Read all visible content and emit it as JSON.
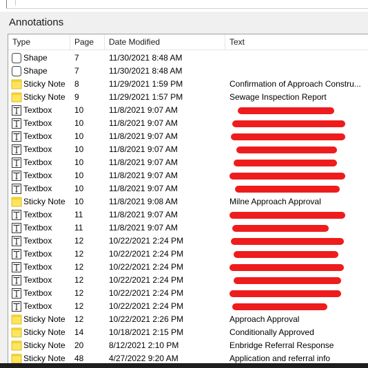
{
  "panel": {
    "title": "Annotations"
  },
  "columns": {
    "type": "Type",
    "page": "Page",
    "date": "Date Modified",
    "text": "Text"
  },
  "rows": [
    {
      "type": "Shape",
      "icon": "shape-icon",
      "page": "7",
      "date": "11/30/2021 8:48 AM",
      "text": ""
    },
    {
      "type": "Shape",
      "icon": "shape-icon",
      "page": "7",
      "date": "11/30/2021 8:48 AM",
      "text": ""
    },
    {
      "type": "Sticky Note",
      "icon": "sticky-note-icon",
      "page": "8",
      "date": "11/29/2021 1:59 PM",
      "text": "Confirmation of Approach Constru..."
    },
    {
      "type": "Sticky Note",
      "icon": "sticky-note-icon",
      "page": "9",
      "date": "11/29/2021 1:57 PM",
      "text": "Sewage Inspection Report"
    },
    {
      "type": "Textbox",
      "icon": "textbox-icon",
      "page": "10",
      "date": "11/8/2021 9:07 AM",
      "text": "",
      "redacted": true
    },
    {
      "type": "Textbox",
      "icon": "textbox-icon",
      "page": "10",
      "date": "11/8/2021 9:07 AM",
      "text": "",
      "redacted": true
    },
    {
      "type": "Textbox",
      "icon": "textbox-icon",
      "page": "10",
      "date": "11/8/2021 9:07 AM",
      "text": "",
      "redacted": true
    },
    {
      "type": "Textbox",
      "icon": "textbox-icon",
      "page": "10",
      "date": "11/8/2021 9:07 AM",
      "text": "",
      "redacted": true
    },
    {
      "type": "Textbox",
      "icon": "textbox-icon",
      "page": "10",
      "date": "11/8/2021 9:07 AM",
      "text": "",
      "redacted": true
    },
    {
      "type": "Textbox",
      "icon": "textbox-icon",
      "page": "10",
      "date": "11/8/2021 9:07 AM",
      "text": "",
      "redacted": true
    },
    {
      "type": "Textbox",
      "icon": "textbox-icon",
      "page": "10",
      "date": "11/8/2021 9:07 AM",
      "text": "",
      "redacted": true
    },
    {
      "type": "Sticky Note",
      "icon": "sticky-note-icon",
      "page": "10",
      "date": "11/8/2021 9:08 AM",
      "text": "Milne Approach Approval"
    },
    {
      "type": "Textbox",
      "icon": "textbox-icon",
      "page": "11",
      "date": "11/8/2021 9:07 AM",
      "text": "",
      "redacted": true
    },
    {
      "type": "Textbox",
      "icon": "textbox-icon",
      "page": "11",
      "date": "11/8/2021 9:07 AM",
      "text": "",
      "redacted": true
    },
    {
      "type": "Textbox",
      "icon": "textbox-icon",
      "page": "12",
      "date": "10/22/2021 2:24 PM",
      "text": "",
      "redacted": true
    },
    {
      "type": "Textbox",
      "icon": "textbox-icon",
      "page": "12",
      "date": "10/22/2021 2:24 PM",
      "text": "",
      "redacted": true
    },
    {
      "type": "Textbox",
      "icon": "textbox-icon",
      "page": "12",
      "date": "10/22/2021 2:24 PM",
      "text": "",
      "redacted": true
    },
    {
      "type": "Textbox",
      "icon": "textbox-icon",
      "page": "12",
      "date": "10/22/2021 2:24 PM",
      "text": "",
      "redacted": true
    },
    {
      "type": "Textbox",
      "icon": "textbox-icon",
      "page": "12",
      "date": "10/22/2021 2:24 PM",
      "text": "",
      "redacted": true
    },
    {
      "type": "Textbox",
      "icon": "textbox-icon",
      "page": "12",
      "date": "10/22/2021 2:24 PM",
      "text": "",
      "redacted": true
    },
    {
      "type": "Sticky Note",
      "icon": "sticky-note-icon",
      "page": "12",
      "date": "10/22/2021 2:26 PM",
      "text": "Approach Approval"
    },
    {
      "type": "Sticky Note",
      "icon": "sticky-note-icon",
      "page": "14",
      "date": "10/18/2021 2:15 PM",
      "text": "Conditionally Approved"
    },
    {
      "type": "Sticky Note",
      "icon": "sticky-note-icon",
      "page": "20",
      "date": "8/12/2021 2:10 PM",
      "text": "Enbridge Referral Response"
    },
    {
      "type": "Sticky Note",
      "icon": "sticky-note-icon",
      "page": "48",
      "date": "4/27/2022 9:20 AM",
      "text": "Application and referral info"
    }
  ],
  "colors": {
    "redaction": "#ee1c1c",
    "sticky_note": "#ffe55c",
    "panel_bg": "#f0f0f0"
  }
}
